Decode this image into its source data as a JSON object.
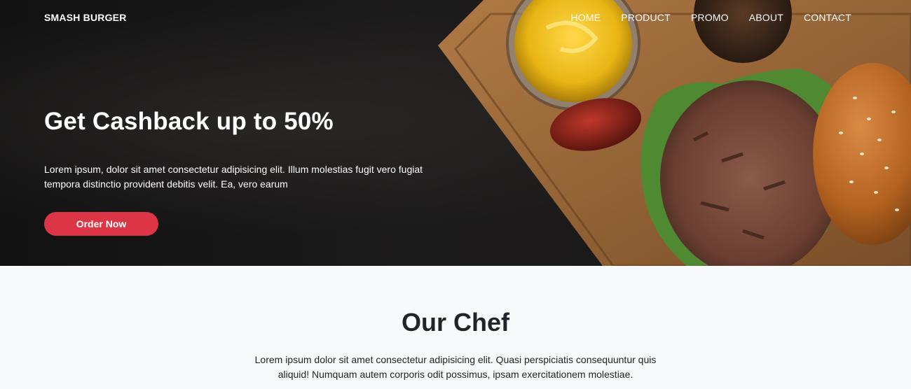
{
  "navbar": {
    "brand": "SMASH BURGER",
    "links": [
      "HOME",
      "PRODUCT",
      "PROMO",
      "ABOUT",
      "CONTACT"
    ]
  },
  "hero": {
    "title": "Get Cashback up to 50%",
    "text": "Lorem ipsum, dolor sit amet consectetur adipisicing elit. Illum molestias fugit vero fugiat tempora distinctio provident debitis velit. Ea, vero earum",
    "button_label": "Order Now"
  },
  "chef": {
    "title": "Our Chef",
    "text": "Lorem ipsum dolor sit amet consectetur adipisicing elit. Quasi perspiciatis consequuntur quis aliquid! Numquam autem corporis odit possimus, ipsam exercitationem molestiae."
  },
  "colors": {
    "accent": "#dc3545",
    "hero_background": "#141414",
    "section_background": "#f8f9fa",
    "text_dark": "#212529"
  }
}
